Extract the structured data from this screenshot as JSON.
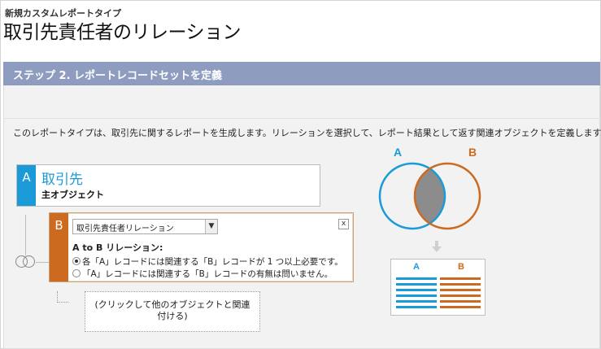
{
  "header": {
    "breadcrumb": "新規カスタムレポートタイプ",
    "title": "取引先責任者のリレーション"
  },
  "step": {
    "title": "ステップ 2. レポートレコードセットを定義"
  },
  "description": "このレポートタイプは、取引先に関するレポートを生成します。リレーションを選択して、レポート結果として返す関連オブジェクトを定義します。",
  "object_a": {
    "letter": "A",
    "name": "取引先",
    "subtitle": "主オブジェクト"
  },
  "object_b": {
    "letter": "B",
    "select_value": "取引先責任者リレーション",
    "close_label": "x",
    "relation_label": "A to B リレーション:",
    "options": [
      {
        "label": "各「A」レコードには関連する「B」レコードが 1 つ以上必要です。",
        "selected": true
      },
      {
        "label": "「A」レコードには関連する「B」レコードの有無は問いません。",
        "selected": false
      }
    ]
  },
  "add_related": {
    "label": "(クリックして他のオブジェクトと関連付ける)"
  },
  "venn": {
    "label_a": "A",
    "label_b": "B",
    "color_a": "#1a9bd7",
    "color_b": "#cc6b1f",
    "overlap_color": "#8c8c8c"
  },
  "result_table": {
    "col_a": "A",
    "col_b": "B"
  }
}
